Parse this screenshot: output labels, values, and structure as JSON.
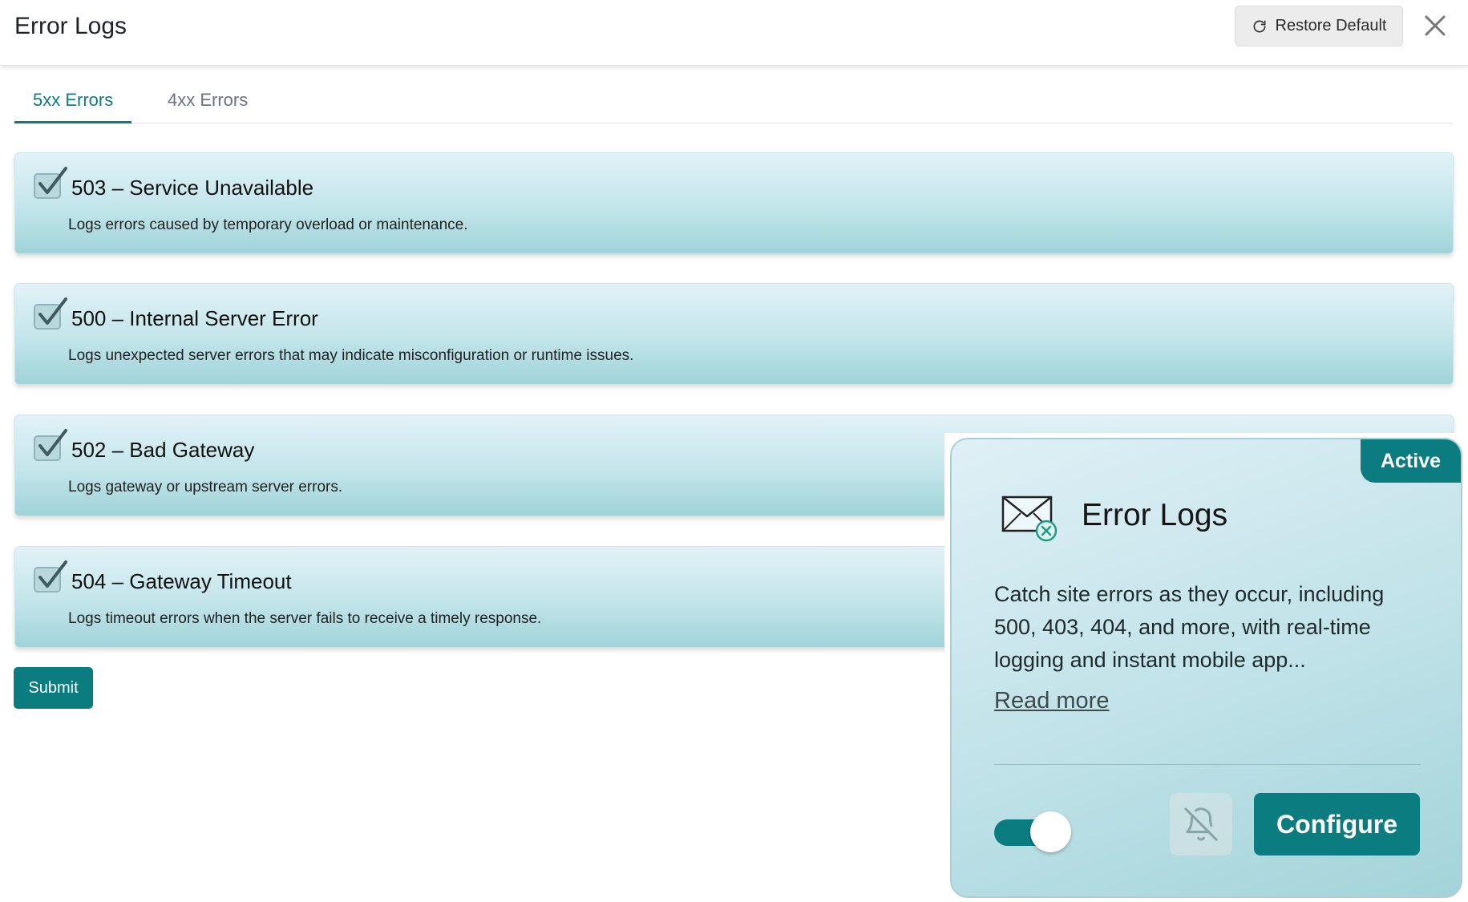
{
  "header": {
    "title": "Error Logs",
    "restore_label": "Restore Default"
  },
  "tabs": [
    {
      "label": "5xx Errors",
      "active": true
    },
    {
      "label": "4xx Errors",
      "active": false
    }
  ],
  "errors": [
    {
      "title": "503 – Service Unavailable",
      "description": "Logs errors caused by temporary overload or maintenance.",
      "checked": true
    },
    {
      "title": "500 – Internal Server Error",
      "description": "Logs unexpected server errors that may indicate misconfiguration or runtime issues.",
      "checked": true
    },
    {
      "title": "502 – Bad Gateway",
      "description": "Logs gateway or upstream server errors.",
      "checked": true
    },
    {
      "title": "504 – Gateway Timeout",
      "description": "Logs timeout errors when the server fails to receive a timely response.",
      "checked": true
    }
  ],
  "submit_label": "Submit",
  "promo": {
    "badge": "Active",
    "title": "Error Logs",
    "description": "Catch site errors as they occur, including 500, 403, 404, and more, with real-time logging and instant mobile app...",
    "read_more": "Read more",
    "toggle_on": true,
    "configure_label": "Configure"
  },
  "icons": {
    "restore": "restore-icon",
    "close": "close-icon",
    "checkbox": "checkbox-checked-icon",
    "mail_error": "mail-error-icon",
    "bell_off": "bell-off-icon"
  },
  "colors": {
    "accent": "#0b7c80",
    "card_gradient_top": "#e2f2f8",
    "card_gradient_bottom": "#9fd3d8"
  }
}
